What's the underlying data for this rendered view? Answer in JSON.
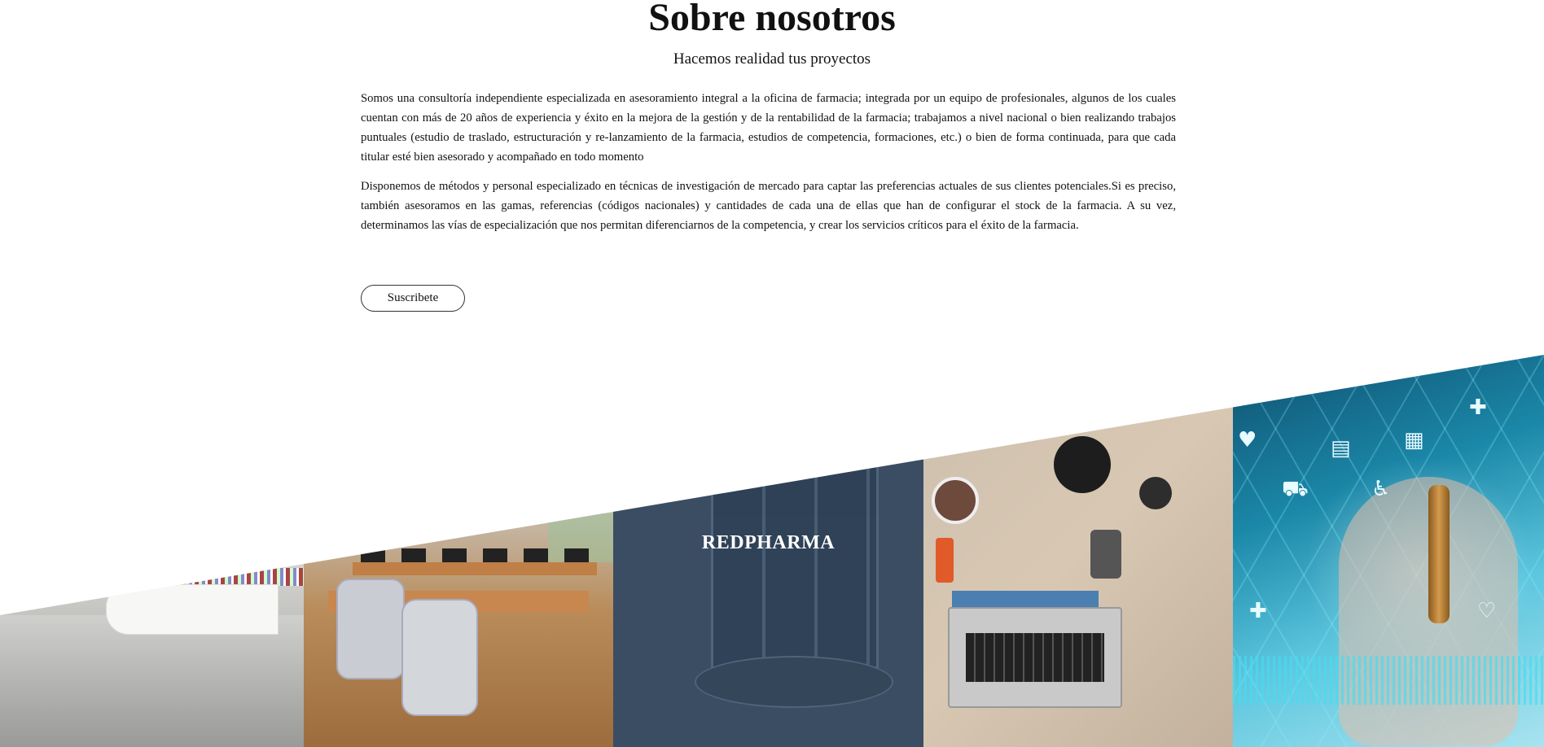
{
  "about": {
    "title": "Sobre nosotros",
    "subtitle": "Hacemos realidad tus proyectos",
    "paragraphs": [
      "Somos una consultoría independiente especializada en asesoramiento integral a la oficina de farmacia; integrada por un equipo de profesionales, algunos de los cuales cuentan con más de 20 años de experiencia y éxito en la mejora de la gestión y de la rentabilidad de la farmacia; trabajamos a nivel nacional o bien realizando trabajos puntuales (estudio de traslado, estructuración y re-lanzamiento de la farmacia, estudios de competencia, formaciones, etc.) o bien de forma continuada, para que cada titular esté bien asesorado y acompañado en todo momento",
      "Disponemos de métodos y personal especializado en técnicas de investigación de mercado para captar las preferencias actuales de sus clientes potenciales.Si es preciso, también asesoramos en las gamas, referencias (códigos nacionales) y cantidades de cada una de ellas que han de configurar el stock de la farmacia. A su vez, determinamos las vías de especialización que nos permitan diferenciarnos de la competencia, y crear los servicios críticos para el éxito de la farmacia."
    ],
    "button_label": "Suscribete"
  },
  "gallery": {
    "tiles": [
      {
        "name": "pharmacy-interior-image"
      },
      {
        "name": "office-desks-image"
      },
      {
        "name": "building-entrance-image",
        "overlay_text": "REDPHARMA"
      },
      {
        "name": "laptop-desk-image"
      },
      {
        "name": "medical-hexagon-icons-image"
      }
    ]
  },
  "colors": {
    "overlay_tile": "#3b4d62",
    "accent_cyan": "#5cc6de"
  }
}
